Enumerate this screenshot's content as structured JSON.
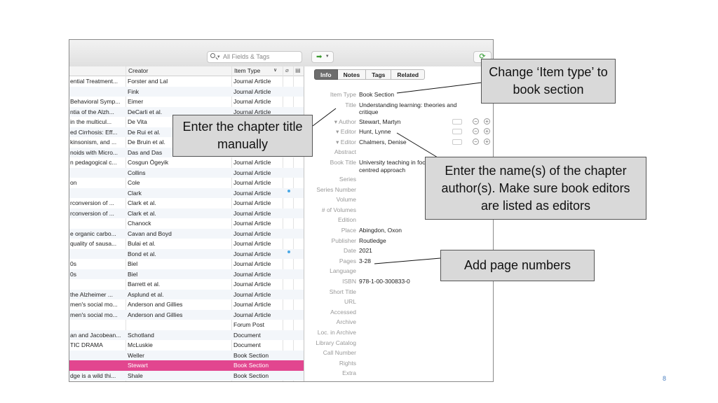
{
  "toolbar": {
    "search_placeholder": "All Fields & Tags",
    "go_arrow": "➡",
    "sync_icon": "⟳"
  },
  "list": {
    "headers": {
      "title": "",
      "creator": "Creator",
      "item_type": "Item Type"
    },
    "rows": [
      {
        "title": "ential Treatment...",
        "creator": "Forster and Lal",
        "type": "Journal Article"
      },
      {
        "title": "",
        "creator": "Fink",
        "type": "Journal Article"
      },
      {
        "title": "Behavioral Symp...",
        "creator": "Eimer",
        "type": "Journal Article"
      },
      {
        "title": "ntia of the Alzh...",
        "creator": "DeCarli et al.",
        "type": "Journal Article"
      },
      {
        "title": "in the multicul...",
        "creator": "De Vita",
        "type": "Journal Article"
      },
      {
        "title": "ed Cirrhosis: Eff...",
        "creator": "De Rui et al.",
        "type": "Journal Article"
      },
      {
        "title": "kinsonism, and ...",
        "creator": "De Bruin et al.",
        "type": "Journal Article"
      },
      {
        "title": "noids with Micro...",
        "creator": "Das and Das",
        "type": "Journal Article"
      },
      {
        "title": "n pedagogical c...",
        "creator": "Cosgun Ögeyik",
        "type": "Journal Article"
      },
      {
        "title": "",
        "creator": "Collins",
        "type": "Journal Article"
      },
      {
        "title": "on",
        "creator": "Cole",
        "type": "Journal Article"
      },
      {
        "title": "",
        "creator": "Clark",
        "type": "Journal Article",
        "dot": true
      },
      {
        "title": "rconversion of ...",
        "creator": "Clark et al.",
        "type": "Journal Article"
      },
      {
        "title": "rconversion of ...",
        "creator": "Clark et al.",
        "type": "Journal Article"
      },
      {
        "title": "",
        "creator": "Chanock",
        "type": "Journal Article"
      },
      {
        "title": "e organic carbo...",
        "creator": "Cavan and Boyd",
        "type": "Journal Article"
      },
      {
        "title": "quality of sausa...",
        "creator": "Bulai et al.",
        "type": "Journal Article"
      },
      {
        "title": "",
        "creator": "Bond et al.",
        "type": "Journal Article",
        "dot": true
      },
      {
        "title": "0s",
        "creator": "Biel",
        "type": "Journal Article"
      },
      {
        "title": "0s",
        "creator": "Biel",
        "type": "Journal Article"
      },
      {
        "title": "",
        "creator": "Barrett et al.",
        "type": "Journal Article"
      },
      {
        "title": "the Alzheimer ...",
        "creator": "Asplund et al.",
        "type": "Journal Article"
      },
      {
        "title": "men's social mo...",
        "creator": "Anderson and Gillies",
        "type": "Journal Article"
      },
      {
        "title": "men's social mo...",
        "creator": "Anderson and Gillies",
        "type": "Journal Article"
      },
      {
        "title": "",
        "creator": "",
        "type": "Forum Post"
      },
      {
        "title": "an and Jacobean...",
        "creator": "Schotland",
        "type": "Document"
      },
      {
        "title": "TIC DRAMA",
        "creator": "McLuskie",
        "type": "Document"
      },
      {
        "title": "",
        "creator": "Weller",
        "type": "Book Section"
      },
      {
        "title": "",
        "creator": "Stewart",
        "type": "Book Section",
        "selected": true
      },
      {
        "title": "dge is a wild thi...",
        "creator": "Shale",
        "type": "Book Section"
      }
    ]
  },
  "pane": {
    "tabs": [
      "Info",
      "Notes",
      "Tags",
      "Related"
    ],
    "fields": [
      {
        "label": "Item Type",
        "value": "Book Section"
      },
      {
        "label": "Title",
        "value": "Understanding learning: theories and critique"
      },
      {
        "label": "▾ Author",
        "value": "Stewart, Martyn"
      },
      {
        "label": "▾ Editor",
        "value": "Hunt, Lynne"
      },
      {
        "label": "▾ Editor",
        "value": "Chalmers, Denise"
      },
      {
        "label": "Abstract",
        "value": ""
      },
      {
        "label": "Book Title",
        "value": "University teaching in focus: a learning-centred approach"
      },
      {
        "label": "Series",
        "value": ""
      },
      {
        "label": "Series Number",
        "value": ""
      },
      {
        "label": "Volume",
        "value": ""
      },
      {
        "label": "# of Volumes",
        "value": ""
      },
      {
        "label": "Edition",
        "value": ""
      },
      {
        "label": "Place",
        "value": "Abingdon, Oxon"
      },
      {
        "label": "Publisher",
        "value": "Routledge"
      },
      {
        "label": "Date",
        "value": "2021"
      },
      {
        "label": "Pages",
        "value": "3-28"
      },
      {
        "label": "Language",
        "value": ""
      },
      {
        "label": "ISBN",
        "value": "978-1-00-300833-0"
      },
      {
        "label": "Short Title",
        "value": ""
      },
      {
        "label": "URL",
        "value": ""
      },
      {
        "label": "Accessed",
        "value": ""
      },
      {
        "label": "Archive",
        "value": ""
      },
      {
        "label": "Loc. in Archive",
        "value": ""
      },
      {
        "label": "Library Catalog",
        "value": ""
      },
      {
        "label": "Call Number",
        "value": ""
      },
      {
        "label": "Rights",
        "value": ""
      },
      {
        "label": "Extra",
        "value": ""
      }
    ]
  },
  "callouts": {
    "item_type": "Change ‘Item type’ to book section",
    "title": "Enter the chapter title manually",
    "authors": "Enter the name(s) of the chapter author(s). Make sure book editors are listed as editors",
    "pages": "Add page numbers"
  },
  "slide_number": "8"
}
